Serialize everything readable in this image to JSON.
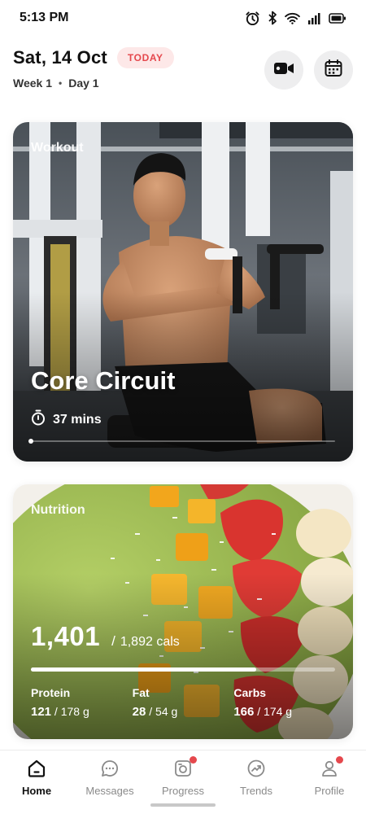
{
  "status_bar": {
    "time": "5:13 PM",
    "icons": [
      "alarm-icon",
      "bluetooth-icon",
      "wifi-icon",
      "signal-icon",
      "battery-icon"
    ]
  },
  "header": {
    "date": "Sat, 14 Oct",
    "today_badge": "TODAY",
    "week": "Week 1",
    "day": "Day 1",
    "separator": "•",
    "actions": [
      "video-camera-icon",
      "calendar-icon"
    ]
  },
  "workout": {
    "label": "Workout",
    "title": "Core Circuit",
    "duration": "37 mins",
    "icon": "stopwatch-icon",
    "progress": 0
  },
  "nutrition": {
    "label": "Nutrition",
    "calories_consumed": "1,401",
    "separator": "/",
    "calories_goal": "1,892 cals",
    "progress": 0.74,
    "macros": [
      {
        "name": "Protein",
        "value": "121",
        "total": " / 178 g"
      },
      {
        "name": "Fat",
        "value": "28",
        "total": " / 54 g"
      },
      {
        "name": "Carbs",
        "value": "166",
        "total": " / 174 g"
      }
    ]
  },
  "nav": {
    "items": [
      {
        "label": "Home",
        "icon": "home-icon",
        "active": true,
        "badge": false
      },
      {
        "label": "Messages",
        "icon": "chat-bubble-icon",
        "active": false,
        "badge": false
      },
      {
        "label": "Progress",
        "icon": "camera-progress-icon",
        "active": false,
        "badge": true
      },
      {
        "label": "Trends",
        "icon": "trend-chart-icon",
        "active": false,
        "badge": false
      },
      {
        "label": "Profile",
        "icon": "user-icon",
        "active": false,
        "badge": true
      }
    ]
  },
  "colors": {
    "accent_red": "#e5484d",
    "badge_bg": "#fde8e8",
    "round_button_bg": "#eeeeef",
    "nav_inactive": "#8a8a8a"
  }
}
